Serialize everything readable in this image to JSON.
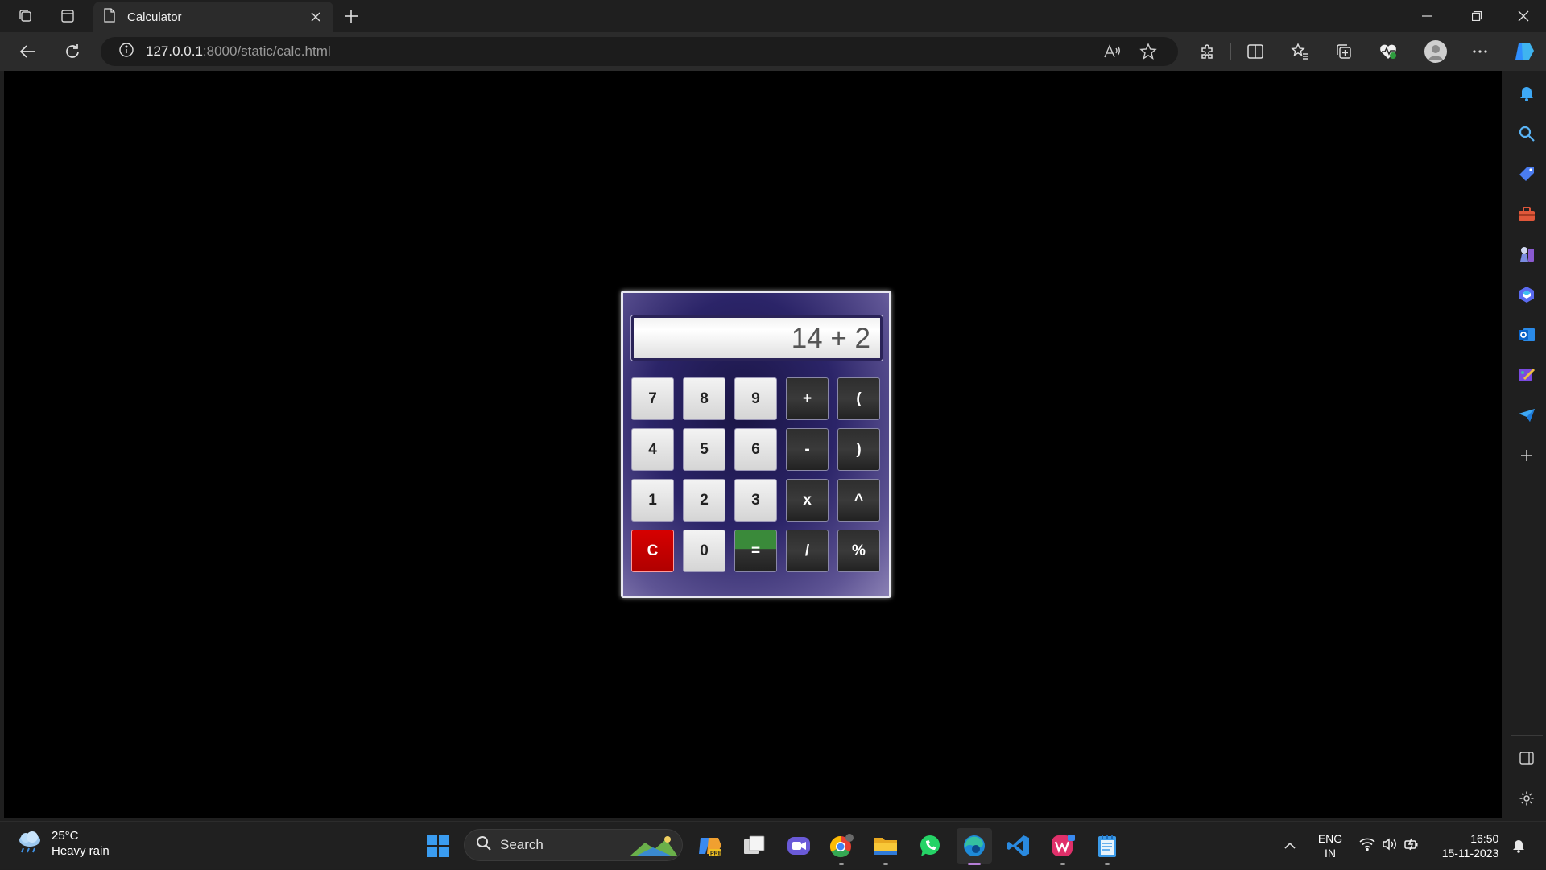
{
  "browser": {
    "tab_title": "Calculator",
    "url_host": "127.0.0.1",
    "url_rest": ":8000/static/calc.html"
  },
  "calculator": {
    "display": "14 + 2",
    "keys": [
      {
        "label": "7",
        "kind": "num"
      },
      {
        "label": "8",
        "kind": "num"
      },
      {
        "label": "9",
        "kind": "num"
      },
      {
        "label": "+",
        "kind": "op"
      },
      {
        "label": "(",
        "kind": "op"
      },
      {
        "label": "4",
        "kind": "num"
      },
      {
        "label": "5",
        "kind": "num"
      },
      {
        "label": "6",
        "kind": "num"
      },
      {
        "label": "-",
        "kind": "op"
      },
      {
        "label": ")",
        "kind": "op"
      },
      {
        "label": "1",
        "kind": "num"
      },
      {
        "label": "2",
        "kind": "num"
      },
      {
        "label": "3",
        "kind": "num"
      },
      {
        "label": "x",
        "kind": "op"
      },
      {
        "label": "^",
        "kind": "op"
      },
      {
        "label": "C",
        "kind": "clear"
      },
      {
        "label": "0",
        "kind": "num"
      },
      {
        "label": "=",
        "kind": "eq"
      },
      {
        "label": "/",
        "kind": "op"
      },
      {
        "label": "%",
        "kind": "op"
      }
    ]
  },
  "taskbar": {
    "weather_temp": "25°C",
    "weather_desc": "Heavy rain",
    "search_label": "Search",
    "lang_top": "ENG",
    "lang_bottom": "IN",
    "time": "16:50",
    "date": "15-11-2023"
  },
  "colors": {
    "page_bg": "#000000",
    "clear_key": "#d00000",
    "equals_top": "#3a8a3a",
    "calc_frame": "#2b2468"
  }
}
